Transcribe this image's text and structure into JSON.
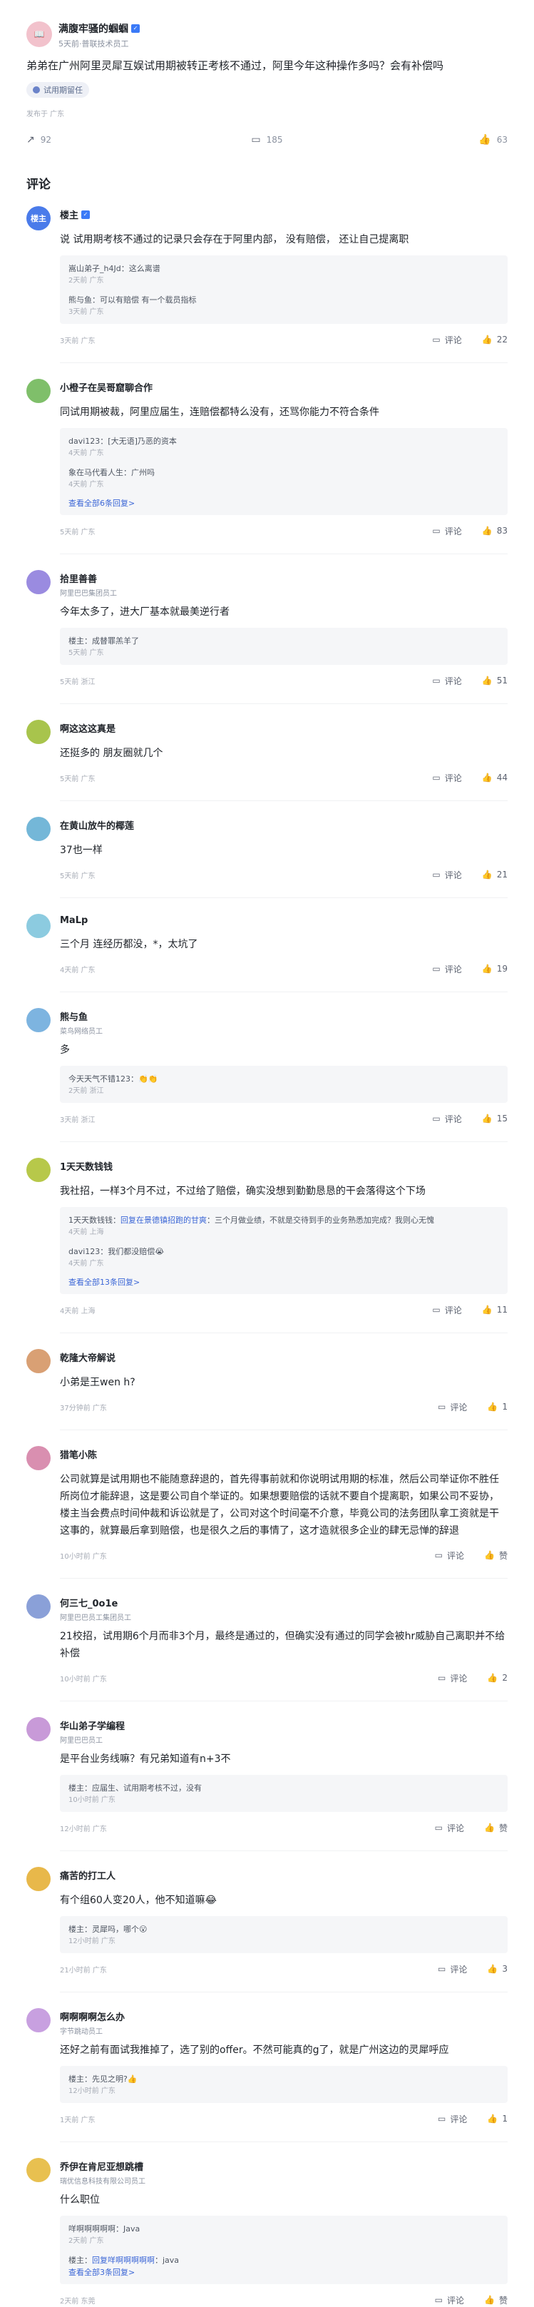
{
  "post": {
    "author": "满腹牢骚的蝈蝈",
    "author_sub": "5天前·普联技术员工",
    "title": "弟弟在广州阿里灵犀互娱试用期被转正考核不通过，阿里今年这种操作多吗？会有补偿吗",
    "tag": "试用期留任",
    "location": "发布于 广东",
    "share": "92",
    "comments": "185",
    "likes": "63"
  },
  "comments_title": "评论",
  "comments": [
    {
      "avatar": "楼主",
      "avatar_color": "#4a7bea",
      "name": "楼主",
      "badge": true,
      "sub": "",
      "text": "说 试用期考核不通过的记录只会存在于阿里内部， 没有赔偿， 还让自己提离职",
      "replies": [
        {
          "html": "嵩山弟子_h4Jd：这么离谱",
          "meta": "2天前 广东"
        },
        {
          "html": "熊与鱼：可以有赔偿 有一个载员指标",
          "meta": "3天前 广东"
        }
      ],
      "see_all": "",
      "loc": "3天前 广东",
      "reply_label": "评论",
      "like": "22"
    },
    {
      "avatar": "",
      "avatar_color": "#7fbf6a",
      "name": "小橙子在吴哥窟聊合作",
      "badge": false,
      "sub": "",
      "text": "同试用期被裁，阿里应届生，连赔偿都特么没有，还骂你能力不符合条件",
      "replies": [
        {
          "html": "davi123：[大无语]乃恶的资本",
          "meta": "4天前 广东"
        },
        {
          "html": "象在马代看人生：广州吗",
          "meta": "4天前 广东"
        }
      ],
      "see_all": "查看全部6条回复>",
      "loc": "5天前 广东",
      "reply_label": "评论",
      "like": "83"
    },
    {
      "avatar": "",
      "avatar_color": "#9a8be0",
      "name": "拾里善善",
      "badge": false,
      "sub": "阿里巴巴集团员工",
      "text": "今年太多了，进大厂基本就最美逆行者",
      "replies": [
        {
          "html": "楼主：成替罪羔羊了",
          "meta": "5天前 广东"
        }
      ],
      "see_all": "",
      "loc": "5天前 浙江",
      "reply_label": "评论",
      "like": "51"
    },
    {
      "avatar": "",
      "avatar_color": "#a8c44c",
      "name": "啊这这这真是",
      "badge": false,
      "sub": "",
      "text": "还挺多的 朋友圈就几个",
      "replies": [],
      "see_all": "",
      "loc": "5天前 广东",
      "reply_label": "评论",
      "like": "44"
    },
    {
      "avatar": "",
      "avatar_color": "#74b7d8",
      "name": "在黄山放牛的椰莲",
      "badge": false,
      "sub": "",
      "text": "37也一样",
      "replies": [],
      "see_all": "",
      "loc": "5天前 广东",
      "reply_label": "评论",
      "like": "21"
    },
    {
      "avatar": "",
      "avatar_color": "#8ccbe0",
      "name": "MaLp",
      "badge": false,
      "sub": "",
      "text": "三个月 连经历都没，*，太坑了",
      "replies": [],
      "see_all": "",
      "loc": "4天前 广东",
      "reply_label": "评论",
      "like": "19"
    },
    {
      "avatar": "",
      "avatar_color": "#7db4e0",
      "name": "熊与鱼",
      "badge": false,
      "sub": "菜鸟网络员工",
      "text": "多",
      "replies": [
        {
          "html": "今天天气不错123：👏👏",
          "meta": "2天前 浙江"
        }
      ],
      "see_all": "",
      "loc": "3天前 浙江",
      "reply_label": "评论",
      "like": "15"
    },
    {
      "avatar": "",
      "avatar_color": "#b7c84a",
      "name": "1天天数钱钱",
      "badge": false,
      "sub": "",
      "text": "我社招，一样3个月不过，不过给了赔偿，确实没想到勤勤恳恳的干会落得这个下场",
      "replies": [
        {
          "html": "1天天数钱钱：回复在景德镇招跑的甘爽：三个月做业绩，不就是交待到手的业务熟悉加完成？我则心无愧",
          "meta": "4天前 上海",
          "hl": "回复在景德镇招跑的甘爽"
        },
        {
          "html": "davi123：我们都没赔偿😭",
          "meta": "4天前 广东"
        }
      ],
      "see_all": "查看全部13条回复>",
      "loc": "4天前 上海",
      "reply_label": "评论",
      "like": "11"
    },
    {
      "avatar": "",
      "avatar_color": "#d9a074",
      "name": "乾隆大帝解说",
      "badge": false,
      "sub": "",
      "text": "小弟是王wen h?",
      "replies": [],
      "see_all": "",
      "loc": "37分钟前 广东",
      "reply_label": "评论",
      "like": "1"
    },
    {
      "avatar": "",
      "avatar_color": "#d98fb0",
      "name": "猎笔小陈",
      "badge": false,
      "sub": "",
      "text": "公司就算是试用期也不能随意辞退的，首先得事前就和你说明试用期的标准，然后公司举证你不胜任所岗位才能辞退，这是要公司自个举证的。如果想要赔偿的话就不要自个提离职，如果公司不妥协，楼主当会费点时间仲裁和诉讼就是了，公司对这个时间毫不介意，毕竟公司的法务团队拿工资就是干这事的，就算最后拿到赔偿，也是很久之后的事情了，这才造就很多企业的肆无忌惮的辞退",
      "replies": [],
      "see_all": "",
      "loc": "10小时前 广东",
      "reply_label": "评论",
      "like": "赞"
    },
    {
      "avatar": "",
      "avatar_color": "#8aa0d8",
      "name": "何三七_0o1e",
      "badge": false,
      "sub": "阿里巴巴员工集团员工",
      "text": "21校招，试用期6个月而非3个月，最终是通过的，但确实没有通过的同学会被hr威胁自己离职并不给补偿",
      "replies": [],
      "see_all": "",
      "loc": "10小时前 广东",
      "reply_label": "评论",
      "like": "2"
    },
    {
      "avatar": "",
      "avatar_color": "#c89ad8",
      "name": "华山弟子学编程",
      "badge": false,
      "sub": "阿里巴巴员工",
      "text": "是平台业务线嘛？有兄弟知道有n+3不",
      "replies": [
        {
          "html": "楼主：应届生、试用期考核不过，没有",
          "meta": "10小时前 广东"
        }
      ],
      "see_all": "",
      "loc": "12小时前 广东",
      "reply_label": "评论",
      "like": "赞"
    },
    {
      "avatar": "",
      "avatar_color": "#e8b84a",
      "name": "痛苦的打工人",
      "badge": false,
      "sub": "",
      "text": "有个组60人变20人，他不知道嘛😂",
      "replies": [
        {
          "html": "楼主：灵犀吗，哪个😮",
          "meta": "12小时前 广东"
        }
      ],
      "see_all": "",
      "loc": "21小时前 广东",
      "reply_label": "评论",
      "like": "3"
    },
    {
      "avatar": "",
      "avatar_color": "#c8a0e0",
      "name": "啊啊啊啊怎么办",
      "badge": false,
      "sub": "字节跳动员工",
      "text": "还好之前有面试我推掉了，选了别的offer。不然可能真的g了，就是广州这边的灵犀呼应",
      "replies": [
        {
          "html": "楼主：先见之明?👍",
          "meta": "12小时前 广东"
        }
      ],
      "see_all": "",
      "loc": "1天前 广东",
      "reply_label": "评论",
      "like": "1"
    },
    {
      "avatar": "",
      "avatar_color": "#e8c050",
      "name": "乔伊在肯尼亚想跳槽",
      "badge": false,
      "sub": "瑞优信息科技有限公司员工",
      "text": "什么职位",
      "replies": [
        {
          "html": "咩啊啊啊啊啊：Java",
          "meta": "2天前 广东"
        },
        {
          "html": "楼主：回复咩啊啊啊啊啊：java",
          "meta": "",
          "hl": "回复咩啊啊啊啊啊"
        }
      ],
      "see_all": "查看全部3条回复>",
      "loc": "2天前 东莞",
      "reply_label": "评论",
      "like": "赞"
    }
  ]
}
